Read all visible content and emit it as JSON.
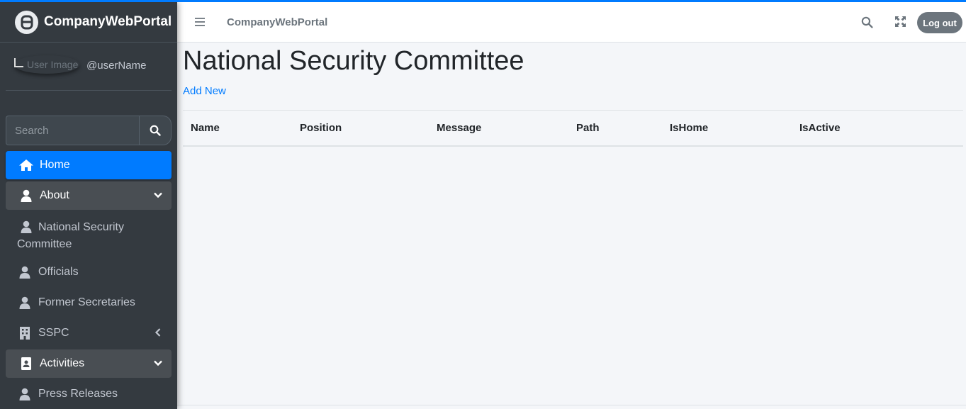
{
  "brand": {
    "name": "CompanyWebPortal"
  },
  "user": {
    "image_alt": "User Image",
    "name": "@userName"
  },
  "sidebar": {
    "search_placeholder": "Search",
    "items": [
      {
        "label": "Home",
        "icon": "home-icon"
      },
      {
        "label": "About",
        "icon": "user-icon"
      },
      {
        "label": "National Security Committee",
        "icon": "user-icon"
      },
      {
        "label": "Officials",
        "icon": "user-icon"
      },
      {
        "label": "Former Secretaries",
        "icon": "user-icon"
      },
      {
        "label": "SSPC",
        "icon": "building-icon"
      },
      {
        "label": "Activities",
        "icon": "id-card-icon"
      },
      {
        "label": "Press Releases",
        "icon": "user-icon"
      }
    ]
  },
  "navbar": {
    "brand": "CompanyWebPortal",
    "logout_label": "Log out"
  },
  "main": {
    "title": "National Security Committee",
    "add_new": "Add New",
    "table": {
      "columns": [
        "Name",
        "Position",
        "Message",
        "Path",
        "IsHome",
        "IsActive"
      ],
      "rows": []
    }
  },
  "colors": {
    "accent": "#007bff",
    "sidebar_bg": "#343a40",
    "content_bg": "#f4f6f9"
  }
}
